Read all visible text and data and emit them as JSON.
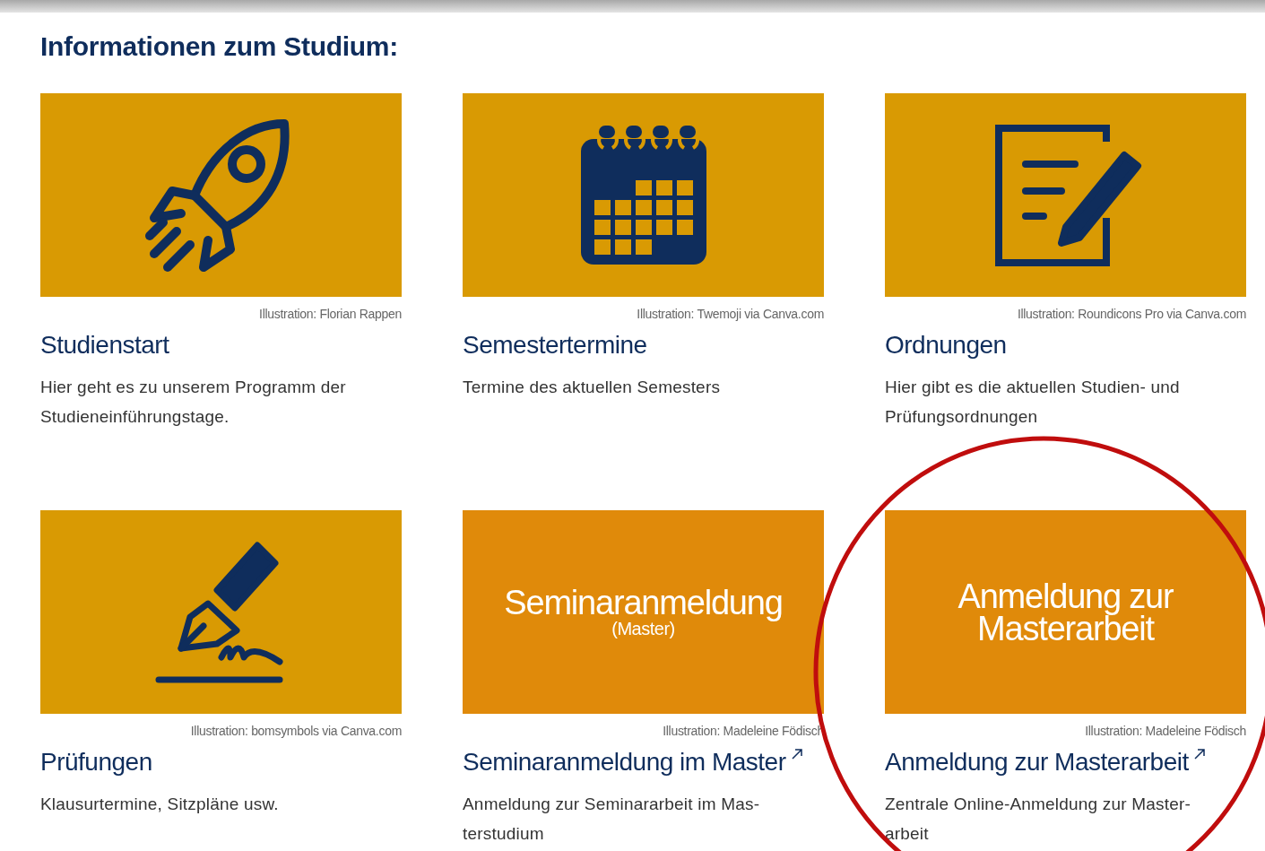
{
  "heading": "Informationen zum Studium:",
  "cards": [
    {
      "tile": {
        "kind": "icon"
      },
      "credit": "Illustration: Florian Rappen",
      "title": "Studienstart",
      "external": false,
      "highlighted": false,
      "description": [
        "Hier geht es zu unserem Programm der",
        "Studieneinführungstage."
      ]
    },
    {
      "tile": {
        "kind": "icon"
      },
      "credit": "Illustration: Twemoji via Canva.com",
      "title": "Semestertermine",
      "external": false,
      "highlighted": false,
      "description": [
        "Termine des aktuellen Semesters"
      ]
    },
    {
      "tile": {
        "kind": "icon"
      },
      "credit": "Illustration: Roundicons Pro via Canva.com",
      "title": "Ordnungen",
      "external": false,
      "highlighted": false,
      "description": [
        "Hier gibt es die aktuellen Studien- und",
        "Prüfungsordnungen"
      ]
    },
    {
      "tile": {
        "kind": "icon"
      },
      "credit": "Illustration: bomsymbols via Canva.com",
      "title": "Prüfungen",
      "external": false,
      "highlighted": false,
      "description": [
        "Klausurtermine, Sitzpläne usw."
      ]
    },
    {
      "tile": {
        "kind": "text",
        "lines": [
          "Seminaranmeldung"
        ],
        "subtitle": "(Master)"
      },
      "credit": "Illustration: Madeleine Födisch",
      "title": "Seminaranmeldung im Master",
      "external": true,
      "highlighted": false,
      "description": [
        "Anmeldung zur Seminararbeit im Mas-",
        "terstudium"
      ]
    },
    {
      "tile": {
        "kind": "text",
        "lines": [
          "Anmeldung zur",
          "Masterarbeit"
        ]
      },
      "credit": "Illustration: Madeleine Födisch",
      "title": "Anmeldung zur Masterarbeit",
      "external": true,
      "highlighted": true,
      "description": [
        "Zentrale Online-Anmeldung zur Master-",
        "arbeit"
      ]
    }
  ]
}
